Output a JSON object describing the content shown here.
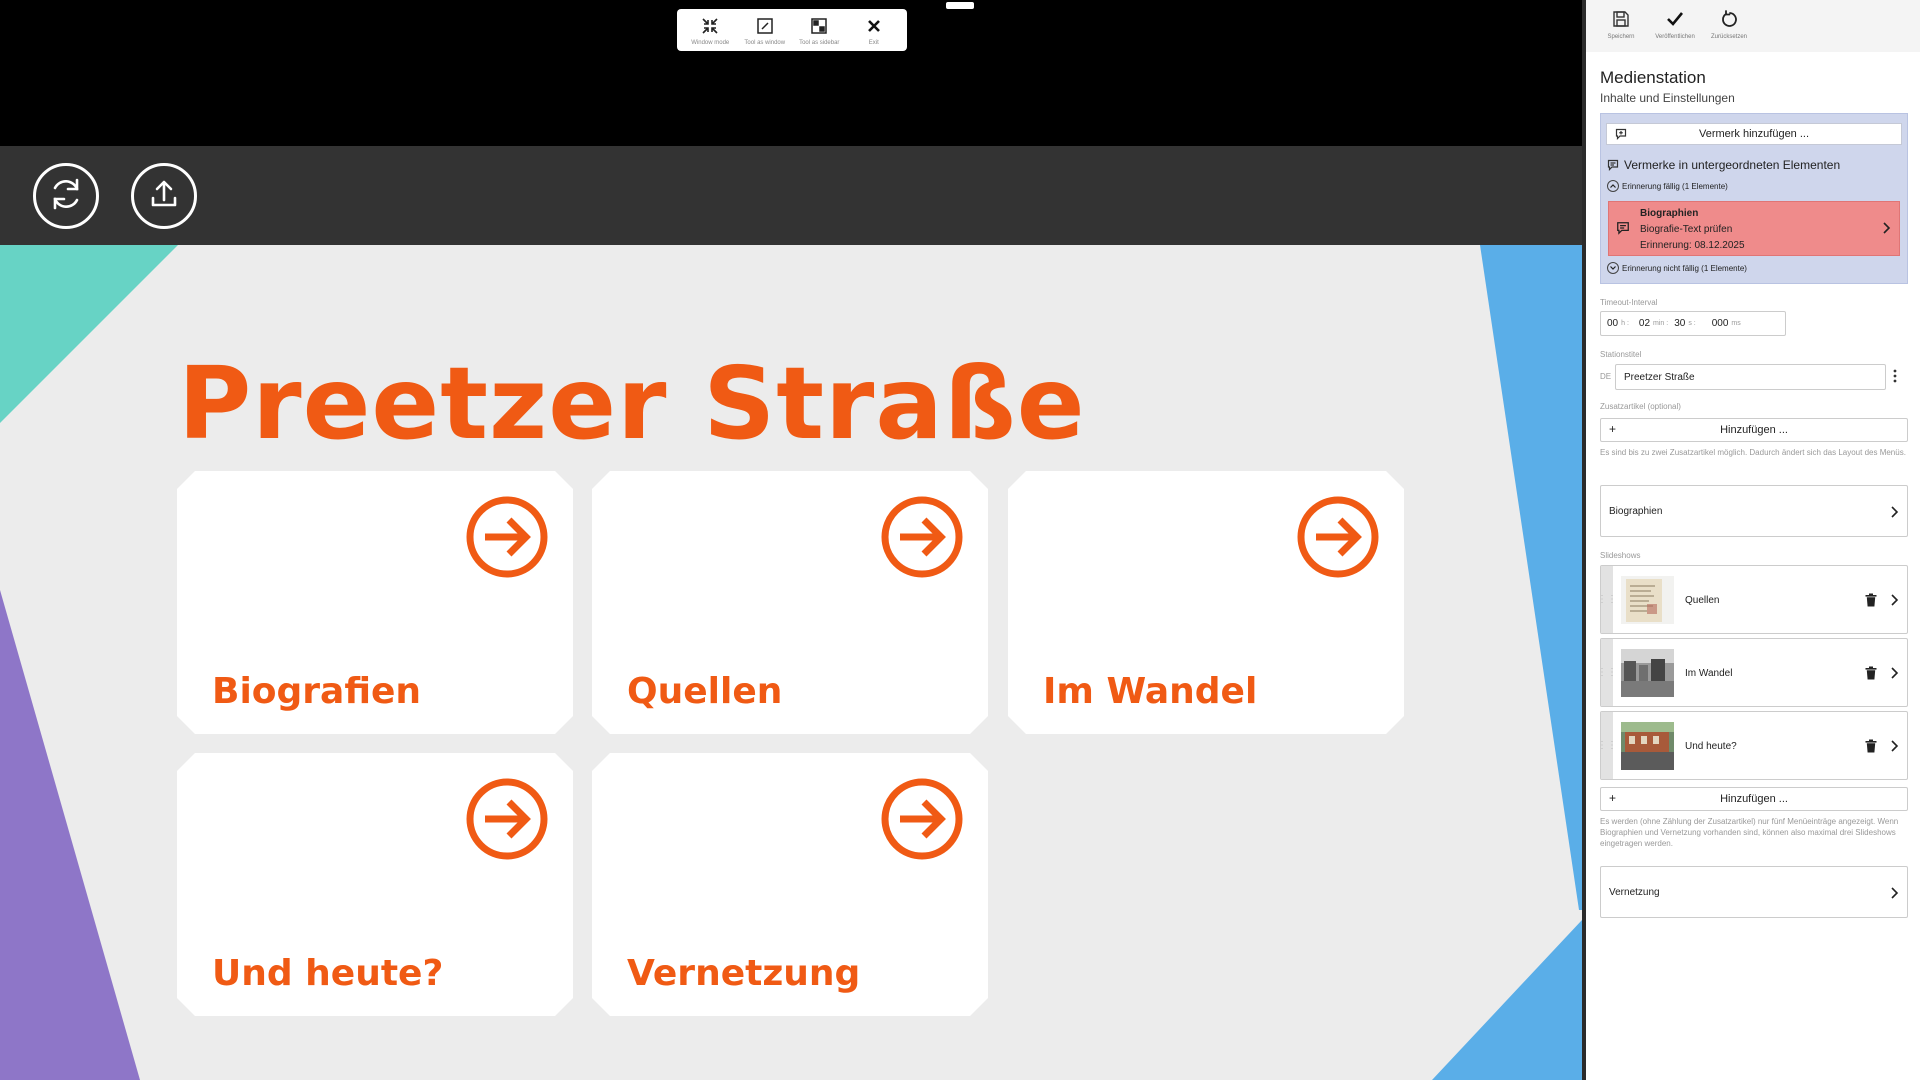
{
  "floating_toolbar": {
    "buttons": [
      {
        "label": "Window mode",
        "icon": "window-mode-icon"
      },
      {
        "label": "Tool as window",
        "icon": "tool-window-icon"
      },
      {
        "label": "Tool as sidebar",
        "icon": "tool-sidebar-icon"
      },
      {
        "label": "Exit",
        "icon": "close-icon"
      }
    ]
  },
  "station_bar": {
    "buttons": [
      {
        "icon": "refresh-icon"
      },
      {
        "icon": "upload-icon"
      }
    ]
  },
  "preview": {
    "title": "Preetzer Straße",
    "accent_color": "#f05a14",
    "tiles": [
      {
        "label": "Biografien"
      },
      {
        "label": "Quellen"
      },
      {
        "label": "Im Wandel"
      },
      {
        "label": "Und heute?"
      },
      {
        "label": "Vernetzung"
      }
    ],
    "shape_colors": {
      "teal": "#67d3c5",
      "purple": "#8e76c8",
      "blue": "#5aaee8"
    }
  },
  "sidebar": {
    "toolbar": [
      {
        "label": "Speichern",
        "icon": "save-icon"
      },
      {
        "label": "Veröffentlichen",
        "icon": "checkmark-icon"
      },
      {
        "label": "Zurücksetzen",
        "icon": "reset-icon"
      }
    ],
    "title": "Medienstation",
    "subtitle": "Inhalte und Einstellungen",
    "notes": {
      "add_button": "Vermerk hinzufügen ...",
      "sub_heading": "Vermerke in untergeordneten Elementen",
      "due_label": "Erinnerung fällig (1 Elemente)",
      "not_due_label": "Erinnerung nicht fällig (1 Elemente)",
      "reminder": {
        "title": "Biographien",
        "text": "Biografie-Text prüfen",
        "date": "Erinnerung: 08.12.2025"
      }
    },
    "timeout": {
      "label": "Timeout-Interval",
      "h": "00",
      "h_unit": "h :",
      "min": "02",
      "min_unit": "min :",
      "s": "30",
      "s_unit": "s :",
      "ms": "000",
      "ms_unit": "ms"
    },
    "station_title": {
      "label": "Stationstitel",
      "lang": "DE",
      "value": "Preetzer Straße"
    },
    "extra_articles": {
      "label": "Zusatzartikel (optional)",
      "add_button": "Hinzufügen ...",
      "hint": "Es sind bis zu zwei Zusatzartikel möglich. Dadurch ändert sich das Layout des Menüs."
    },
    "biographies_row": "Biographien",
    "slideshows": {
      "label": "Slideshows",
      "items": [
        {
          "name": "Quellen"
        },
        {
          "name": "Im Wandel"
        },
        {
          "name": "Und heute?"
        }
      ],
      "add_button": "Hinzufügen ...",
      "hint": "Es werden (ohne Zählung der Zusatzartikel) nur fünf Menüeinträge angezeigt. Wenn Biographien und Vernetzung vorhanden sind, können also maximal drei Slideshows eingetragen werden."
    },
    "network_row": "Vernetzung",
    "reminder_color": "#ef8b8b",
    "notes_bg_color": "#cfd6ec"
  }
}
